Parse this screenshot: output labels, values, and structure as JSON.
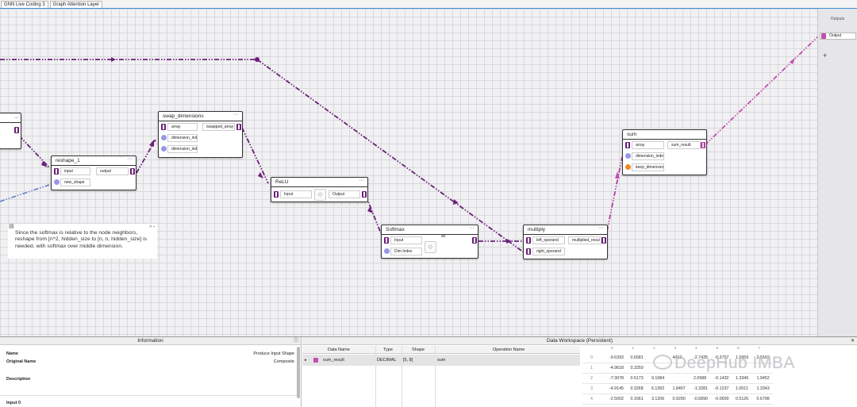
{
  "tabs": [
    "GNN Live Coding 3",
    "Graph Attention Layer"
  ],
  "outputs_panel": {
    "header": "Outputs",
    "output_label": "Output",
    "add_label": "+"
  },
  "nodes": {
    "reshape": {
      "title": "reshape_1",
      "input_label": "input",
      "output_label": "output",
      "shape_label": "new_shape"
    },
    "swap": {
      "title": "swap_dimensions",
      "array_label": "array",
      "output_label": "swapped_array",
      "dim1_label": "dimension_inde",
      "dim2_label": "dimension_inde"
    },
    "relu": {
      "title": "ReLU",
      "input_label": "Input",
      "output_label": "Output"
    },
    "softmax": {
      "title": "Softmax",
      "input_label": "Input",
      "dim_label": "Dim Index",
      "output_label": "ax"
    },
    "multiply": {
      "title": "multiply",
      "left_label": "left_operand",
      "right_label": "right_operand",
      "output_label": "multiplied_resul"
    },
    "sum": {
      "title": "sum",
      "array_label": "array",
      "output_label": "sum_result",
      "dim_label": "dimension_inde",
      "keep_label": "keep_dimension"
    }
  },
  "note": {
    "text": "Since the softmax is relative to the node neighbors, reshape from [n^2, hidden_size to [n, n, hidden_size] is needed, with softmax over middle dimension."
  },
  "information": {
    "title": "Information",
    "name_key": "Name",
    "name_value": "Produce Input Shape",
    "original_key": "Original Name",
    "original_value": "Composite",
    "description_key": "Description",
    "input_key": "Input 0"
  },
  "workspace": {
    "title": "Data Workspace (Persistent)",
    "columns": [
      "Data Name",
      "Type",
      "Shape",
      "Operation Name"
    ],
    "row": {
      "name": "sum_result",
      "type": "DECIMAL",
      "shape": "[5, 8]",
      "operation": "sum"
    },
    "matrix_col_headers": [
      "0",
      "1",
      "2",
      "3",
      "4",
      "5",
      "6",
      "7"
    ],
    "matrix_rows": [
      {
        "idx": "0",
        "vals": [
          "-9.6393",
          "0.6581",
          "",
          "4413",
          "-2.7435",
          "-0.3757",
          "1.5959",
          "2.5592"
        ]
      },
      {
        "idx": "1",
        "vals": [
          "-4.9618",
          "0.3259",
          "",
          "",
          "",
          "",
          "",
          ""
        ]
      },
      {
        "idx": "2",
        "vals": [
          "-7.3078",
          "0.5173",
          "9.1084",
          "",
          "2.0588",
          "-0.1432",
          "1.3340",
          "1.9452"
        ]
      },
      {
        "idx": "3",
        "vals": [
          "-4.9145",
          "0.3268",
          "6.1392",
          "1.8407",
          "-1.3281",
          "-0.1237",
          "1.0011",
          "1.3343"
        ]
      },
      {
        "idx": "4",
        "vals": [
          "-2.5002",
          "0.1661",
          "3.1206",
          "0.9290",
          "-0.6890",
          "-0.0600",
          "0.5126",
          "0.6798"
        ]
      }
    ]
  },
  "watermark": "DeepHub IMBA",
  "colors": {
    "wire_dark": "#6a1f78",
    "wire_pink": "#b03ca1",
    "wire_blue": "#6f86c8",
    "accent": "#3a8fd6"
  }
}
